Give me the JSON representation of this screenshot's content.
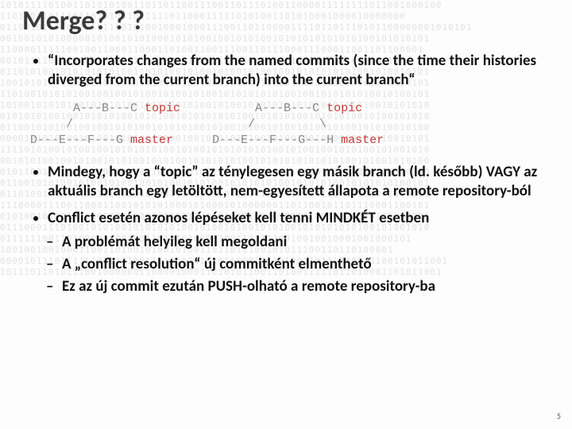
{
  "title": "Merge? ? ?",
  "bullet1": "“Incorporates changes from the named commits (since the time their histories diverged from the current branch) into the current branch“",
  "diagram_left_l1": "      A---B---C ",
  "diagram_left_l1_branch": "topic",
  "diagram_left_l2": "     /",
  "diagram_left_l3": "D---E---F---G ",
  "diagram_left_l3_branch": "master",
  "diagram_right_l1": "      A---B---C ",
  "diagram_right_l1_branch": "topic",
  "diagram_right_l2": "     /         \\",
  "diagram_right_l3": "D---E---F---G---H ",
  "diagram_right_l3_branch": "master",
  "bullet2": "Mindegy, hogy a “topic” az ténylegesen egy másik branch  (ld. később) VAGY az aktuális branch egy letöltött, nem-egyesített állapota a remote repository-ból",
  "bullet3": "Conflict esetén azonos lépéseket kell tenni MINDKÉT esetben",
  "sub1": "A problémát helyileg kell megoldani",
  "sub2": "A „conflict resolution“ új commitként elmenthető",
  "sub3": "Ez az új commit ezután PUSH-olható a remote repository-ba",
  "pagenum": "5",
  "bg_binary": "1010111101001101010100110110110011100110111010011000011111111011001000100\n1101101101110110101001011111011000111110101001101010001000010000000\n011001011010010101100101001000100011100110110000111101101110101100000001010101\n00100101010000010100101010001010100100101010010101010101010100101010101\n1100001111100100110001100011010011001110011011100011100011001101100001\n001011110111100110001011111010011111111110010111100010110101100110\n01101010010101010101001101010010100101001010010010101010101001010010101\n10010101001010101001010101001010010101010101010010100101010101010010101\n11010010101010010010010100101001010010101010101001001010101010010100101\n10100101010100101010100101010010100101001010101010101010101010010101010\n01010101001001010101001010100101010101010010101010010101010010100101010\n01100101010010010010101001010101001010010100101001010010100101010010100\n00001010101001010010101001010010010101010100101001001010010101010010101\n11110101001010010010101010100101001010101010100101001001010100101001010\n00101010010010100101010010101001010101010010101010101010100101001010100\n01011001001010111010001011010000101100101110110111100101010010100010000\n01100101010010100101001001010010101001010101010010101010010101010100101\n01101001010101001010100101001010101010010101001010010101010101001010010\n11100001110011000110010101010001010001010000001101100101101110001100101\n01010010100101010100101001010101010101010100101001010010010100101010010\n01110001110100101010010101010100101001010010101001010101010100101001010\n01111110011010000010010011010101000010011011110010010010001001000101\n10010010010001100110100101001010011011010100101011100110110100001\n00001011101111110111111011111101011101100011110100110111100010100101011001\n1011101101011100100000011000010001101010110011010011111011010001101011001"
}
